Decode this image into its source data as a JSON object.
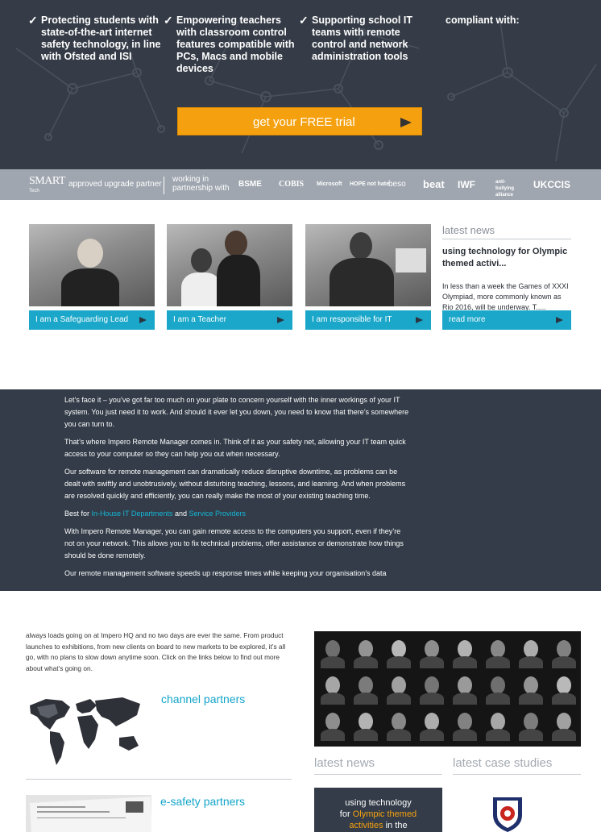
{
  "hero": {
    "features": [
      {
        "text": "Protecting students with state-of-the-art internet safety technology, in line with Ofsted and ISI"
      },
      {
        "text": "Empowering teachers with classroom control features compatible with PCs, Macs and mobile devices"
      },
      {
        "text": "Supporting school IT teams with remote control and network administration tools"
      }
    ],
    "compliant": "compliant with:",
    "cta_label": "get your FREE trial"
  },
  "partners": {
    "smart": "SMART",
    "smart_sub": "Tech",
    "approved": "approved upgrade partner",
    "working_line1": "working in",
    "working_line2": "partnership with",
    "logos": [
      "BSME",
      "COBIS",
      "Microsoft",
      "HOPE not hate",
      "beso",
      "beat",
      "IWF",
      "anti-bullying alliance",
      "UKCCIS"
    ]
  },
  "tiles": [
    {
      "label": "I am a Safeguarding Lead"
    },
    {
      "label": "I am a Teacher"
    },
    {
      "label": "I am responsible for IT"
    }
  ],
  "latest_news_side": {
    "heading": "latest news",
    "title": "using technology for Olympic themed activi...",
    "excerpt": "In less than a week the Games of XXXI Olympiad, more commonly known as Rio 2016, will be underway. T.....",
    "read_more": "read more"
  },
  "band": {
    "p1": "Let’s face it – you’ve got far too much on your plate to concern yourself with the inner workings of your IT system. You just need it to work. And should it ever let you down, you need to know that there’s somewhere you can turn to.",
    "p2": "That’s where Impero Remote Manager comes in. Think of it as your safety net, allowing your IT team quick access to your computer so they can help you out when necessary.",
    "p3": "Our software for remote management can dramatically reduce disruptive downtime, as problems can be dealt with swiftly and unobtrusively, without disturbing teaching, lessons, and learning. And when problems are resolved quickly and efficiently, you can really make the most of your existing teaching time.",
    "best_for": "Best for",
    "link1": "In-House IT Departments",
    "and": "and",
    "link2": "Service Providers",
    "p5": "With Impero Remote Manager, you can gain remote access to the computers you support, even if they’re not on your network. This allows you to fix technical problems, offer assistance or demonstrate how things should be done remotely.",
    "p6": "Our remote management software speeds up response times while keeping your organisation’s data"
  },
  "lower": {
    "intro": "always loads going on at Impero HQ and no two days are ever the same. From product launches to exhibitions, from new clients on board to new markets to be explored, it’s all go, with no plans to slow down anytime soon. Click on the links below to find out more about what’s going on.",
    "channel_partners": "channel partners",
    "esafety_partners": "e-safety partners",
    "latest_news": "latest news",
    "latest_case_studies": "latest case studies",
    "card_line1": "using technology",
    "card_for": "for",
    "card_highlight1": "Olympic themed",
    "card_highlight2": "activities",
    "card_in_the": "in the"
  },
  "colors": {
    "dark": "#353c47",
    "accent": "#1aa7c9",
    "orange": "#f5a10f",
    "grey": "#9fa6af"
  }
}
